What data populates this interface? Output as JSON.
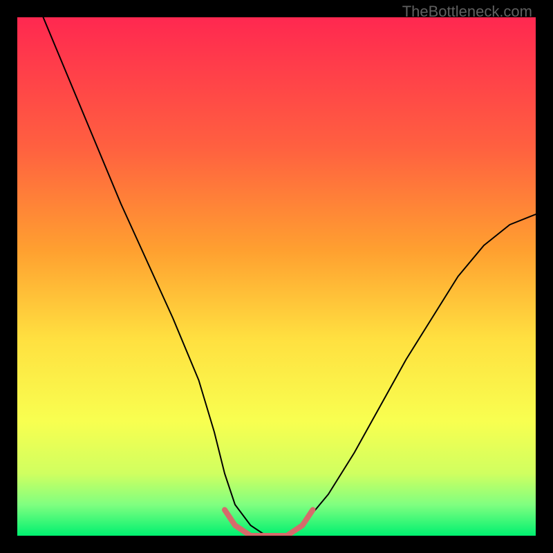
{
  "watermark": "TheBottleneck.com",
  "chart_data": {
    "type": "line",
    "title": "",
    "xlabel": "",
    "ylabel": "",
    "xlim": [
      0,
      100
    ],
    "ylim": [
      0,
      100
    ],
    "grid": false,
    "background_gradient": {
      "top": "#ff2850",
      "mid_upper": "#ff9a30",
      "mid": "#ffe040",
      "mid_lower": "#f5ff60",
      "lower": "#80ff80",
      "bottom": "#00ff66"
    },
    "series": [
      {
        "name": "main-curve",
        "color": "#000000",
        "stroke_width": 2,
        "x": [
          5,
          10,
          15,
          20,
          25,
          30,
          35,
          38,
          40,
          42,
          45,
          48,
          50,
          52,
          55,
          60,
          65,
          70,
          75,
          80,
          85,
          90,
          95,
          100
        ],
        "y": [
          100,
          88,
          76,
          64,
          53,
          42,
          30,
          20,
          12,
          6,
          2,
          0,
          0,
          0,
          2,
          8,
          16,
          25,
          34,
          42,
          50,
          56,
          60,
          62
        ]
      },
      {
        "name": "bottom-highlight",
        "color": "#d66b6b",
        "stroke_width": 8,
        "x": [
          40,
          42,
          45,
          48,
          50,
          52,
          55,
          57
        ],
        "y": [
          5,
          2,
          0,
          0,
          0,
          0,
          2,
          5
        ]
      }
    ]
  }
}
